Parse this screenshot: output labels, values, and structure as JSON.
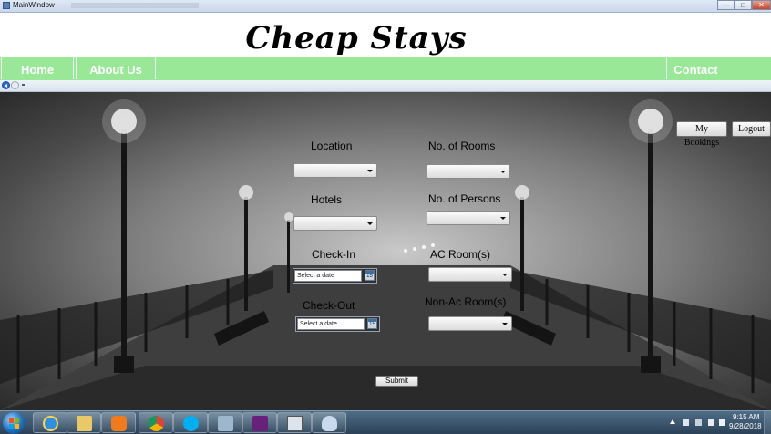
{
  "window": {
    "title": "MainWindow",
    "minimize_glyph": "—",
    "maximize_glyph": "□",
    "close_glyph": "✕"
  },
  "header": {
    "title": "Cheap Stays"
  },
  "nav": {
    "home": "Home",
    "about": "About Us",
    "contact": "Contact Us"
  },
  "account": {
    "my_bookings": "My Bookings",
    "logout": "Logout"
  },
  "form": {
    "location_label": "Location",
    "hotels_label": "Hotels",
    "checkin_label": "Check-In",
    "checkout_label": "Check-Out",
    "rooms_label": "No. of Rooms",
    "persons_label": "No. of Persons",
    "ac_label": "AC Room(s)",
    "nonac_label": "Non-Ac Room(s)",
    "date_placeholder": "Select a date",
    "calendar_glyph": "15",
    "submit": "Submit",
    "location_value": "",
    "hotels_value": "",
    "rooms_value": "",
    "persons_value": "",
    "ac_value": "",
    "nonac_value": ""
  },
  "taskbar": {
    "apps": [
      "internet-explorer-icon",
      "file-explorer-icon",
      "media-player-icon",
      "chrome-icon",
      "skype-icon",
      "network-tool-icon",
      "visual-studio-icon",
      "calculator-icon",
      "paint-icon"
    ],
    "time": "9:15 AM",
    "date": "9/28/2018"
  },
  "colors": {
    "nav_green": "#98e897",
    "nav_text": "#ffffff",
    "titlebar": "#c9d7ea",
    "taskbar": "#2b4258"
  }
}
